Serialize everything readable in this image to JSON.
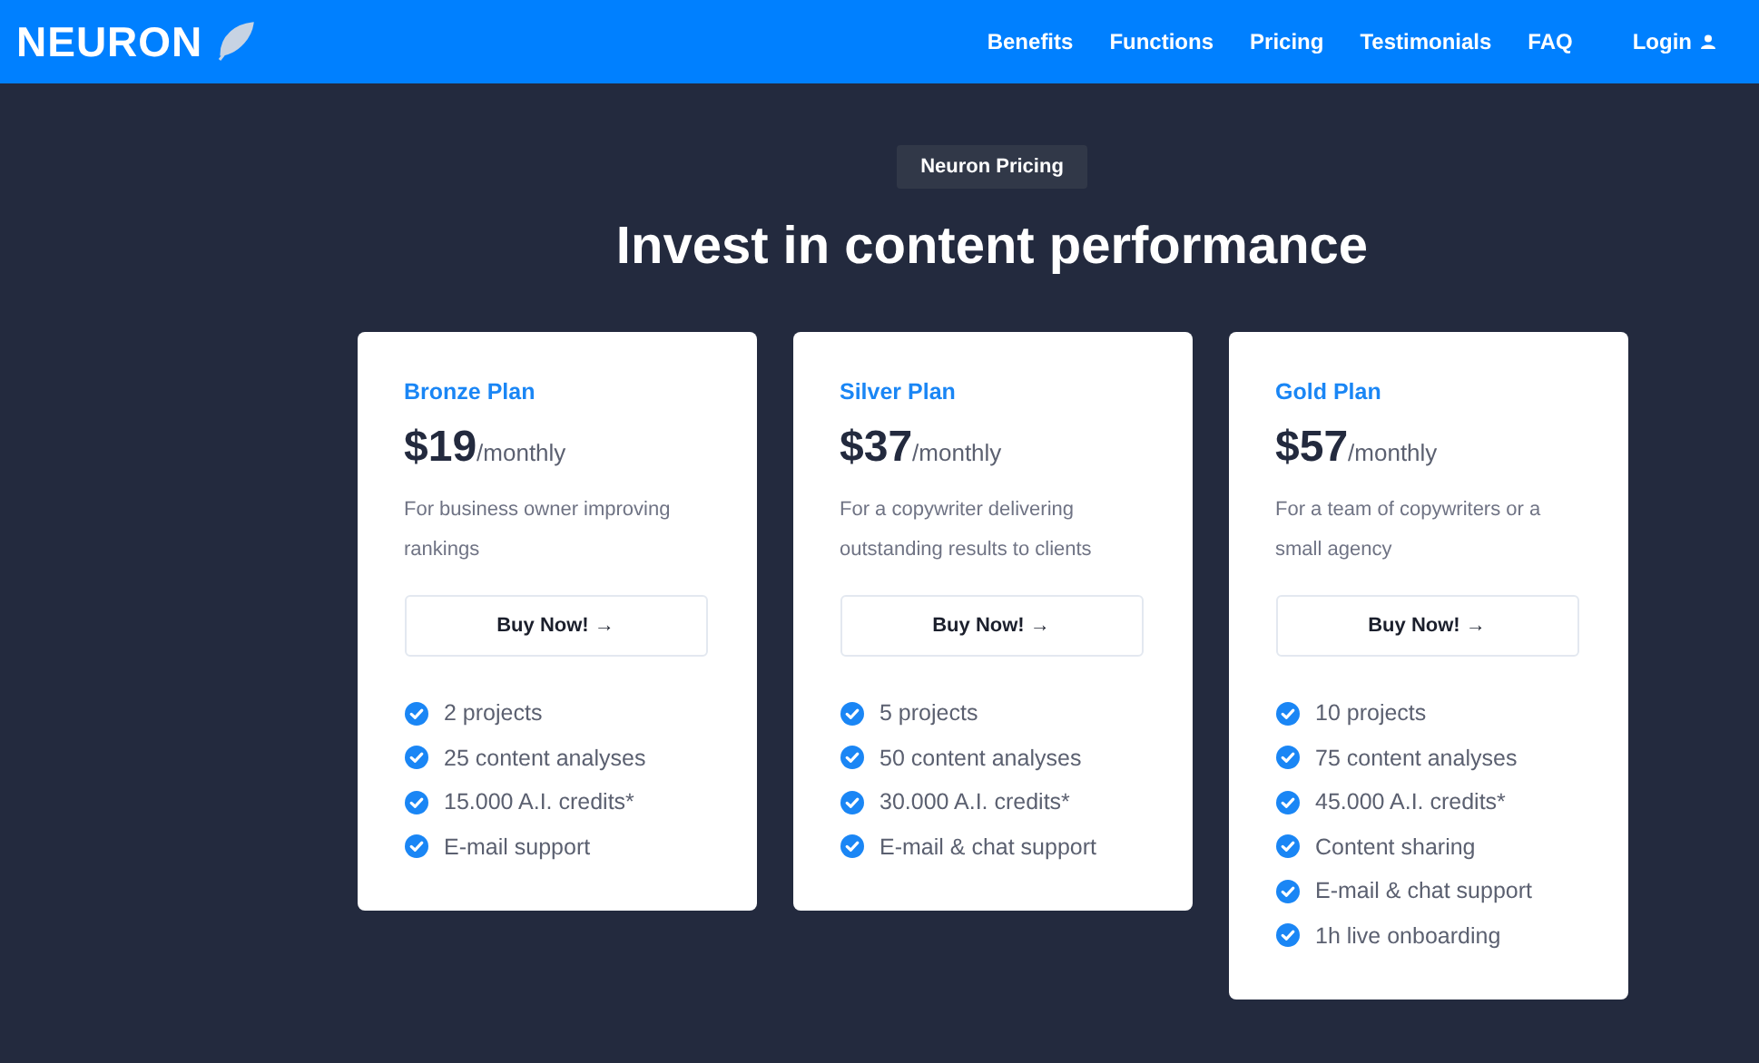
{
  "nav": {
    "logo": "NEURON",
    "links": [
      "Benefits",
      "Functions",
      "Pricing",
      "Testimonials",
      "FAQ"
    ],
    "login": "Login"
  },
  "badge": "Neuron Pricing",
  "heading": "Invest in content performance",
  "plans": [
    {
      "name": "Bronze Plan",
      "price": "$19",
      "period": "/monthly",
      "description": "For business owner improving rankings",
      "button": "Buy Now! →",
      "features": [
        "2 projects",
        "25 content analyses",
        "15.000 A.I. credits*",
        "E-mail support"
      ]
    },
    {
      "name": "Silver Plan",
      "price": "$37",
      "period": "/monthly",
      "description": "For a copywriter delivering outstanding results to clients",
      "button": "Buy Now! →",
      "features": [
        "5 projects",
        "50 content analyses",
        "30.000 A.I. credits*",
        "E-mail & chat support"
      ]
    },
    {
      "name": "Gold Plan",
      "price": "$57",
      "period": "/monthly",
      "description": "For a team of copywriters or a small agency",
      "button": "Buy Now! →",
      "features": [
        "10 projects",
        "75 content analyses",
        "45.000 A.I. credits*",
        "Content sharing",
        "E-mail & chat support",
        "1h live onboarding"
      ]
    }
  ]
}
